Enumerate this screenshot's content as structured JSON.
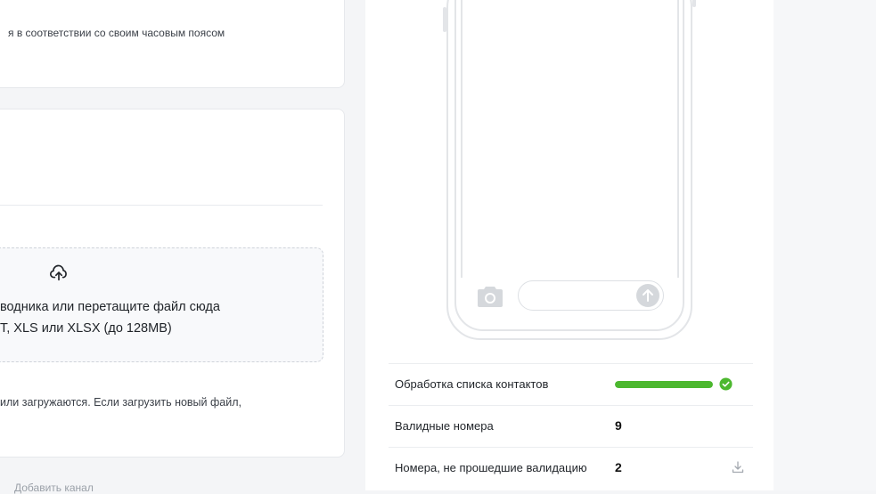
{
  "settings": {
    "timezone_note": "я в соответствии со своим часовым поясом"
  },
  "upload": {
    "line1": "водника или перетащите файл сюда",
    "line2": "T, XLS или XLSX (до 128MB)",
    "note": "или загружаются. Если загрузить новый файл,"
  },
  "footer": {
    "add_channel": "Добавить канал"
  },
  "stats": {
    "processing": {
      "label": "Обработка списка контактов",
      "progress": 1.0,
      "status": "done"
    },
    "valid": {
      "label": "Валидные номера",
      "value": "9"
    },
    "invalid": {
      "label": "Номера, не прошедшие валидацию",
      "value": "2"
    }
  },
  "colors": {
    "progress": "#4cb82f",
    "check": "#4cb82f",
    "phone_outline": "#e3e5e8"
  },
  "icons": [
    "upload-icon",
    "camera-icon",
    "send-icon",
    "check-circle-icon",
    "download-icon"
  ]
}
